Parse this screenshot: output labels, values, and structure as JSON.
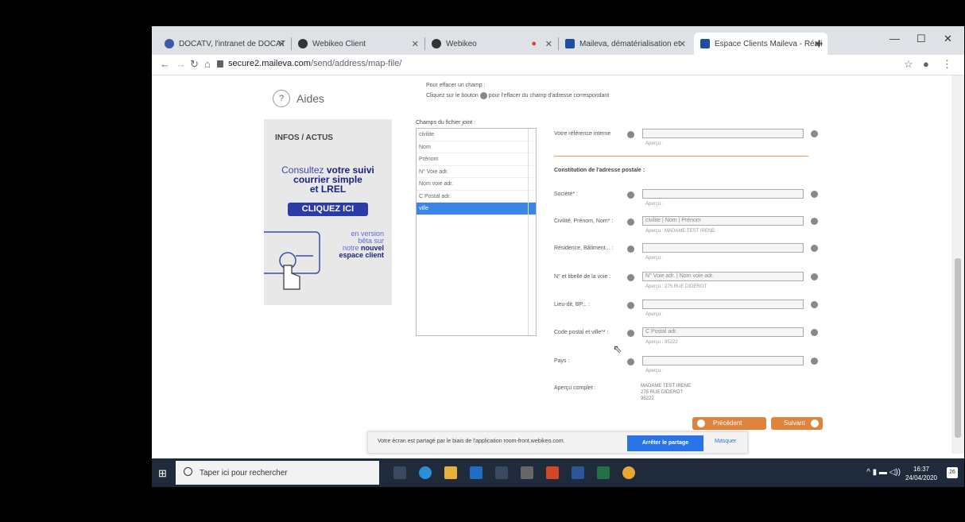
{
  "browser": {
    "tabs": [
      {
        "title": "DOCATV, l'intranet de DOCAT",
        "favicon_color": "#3b5ba9"
      },
      {
        "title": "Webikeo Client",
        "favicon_color": "#333333"
      },
      {
        "title": "Webikeo",
        "favicon_color": "#333333"
      },
      {
        "title": "Maileva, dématérialisation et",
        "favicon_color": "#1f4fa0"
      },
      {
        "title": "Espace Clients Maileva - Réali",
        "favicon_color": "#1f4fa0"
      }
    ],
    "url_host": "secure2.maileva.com",
    "url_path": "/send/address/map-file/"
  },
  "sidebar": {
    "aides": "Aides",
    "infos_title": "INFOS / ACTUS",
    "consult_1": "Consultez ",
    "consult_2": "votre suivi courrier simple",
    "consult_3": "et LREL",
    "cta": "CLIQUEZ ICI",
    "beta_1": "en version",
    "beta_2": "bêta sur",
    "beta_3": "notre ",
    "beta_4": "nouvel",
    "beta_5": "espace client"
  },
  "instructions": {
    "title": "Pour effacer un champ :",
    "text_a": "Cliquez sur le bouton",
    "text_b": "pour l'effacer du champ d'adresse correspondant"
  },
  "fields": {
    "label": "Champs du fichier joint :",
    "items": [
      "civilite",
      "Nom",
      "Prénom",
      "N° Voie adr.",
      "Nom voie adr.",
      "C Postal adr.",
      "ville"
    ]
  },
  "form": {
    "ref_label": "Votre référence interne",
    "section_title": "Constitution de l'adresse postale :",
    "apercu": "Aperçu :",
    "rows": [
      {
        "label": "Société* :",
        "value": "",
        "preview": ""
      },
      {
        "label": "Civilité, Prénom, Nom* :",
        "value": "civilite | Nom | Prénom",
        "preview": "MADAME TEST IRENE"
      },
      {
        "label": "Résidence, Bâtiment... :",
        "value": "",
        "preview": ""
      },
      {
        "label": "N° et libellé de la voie :",
        "value": "N° Voie adr. | Nom voie adr.",
        "preview": "275 RUE DIDEROT"
      },
      {
        "label": "Lieu-dit, BP... :",
        "value": "",
        "preview": ""
      },
      {
        "label": "Code postal et ville** :",
        "value": "C Postal adr.",
        "preview": "95222"
      },
      {
        "label": "Pays :",
        "value": "",
        "preview": ""
      }
    ],
    "apercu_complet_label": "Aperçu complet :",
    "apercu_complet": [
      "MADAME TEST IRENE",
      "275 RUE DIDEROT",
      "95222"
    ],
    "prev": "Précédent",
    "next": "Suivant"
  },
  "share": {
    "text": "Votre écran est partagé par le biais de l'application room-front.webikeo.com.",
    "stop": "Arrêter le partage",
    "hide": "Masquer"
  },
  "taskbar": {
    "search": "Taper ici pour rechercher",
    "time": "16:37",
    "date": "24/04/2020",
    "notifications": "26"
  }
}
